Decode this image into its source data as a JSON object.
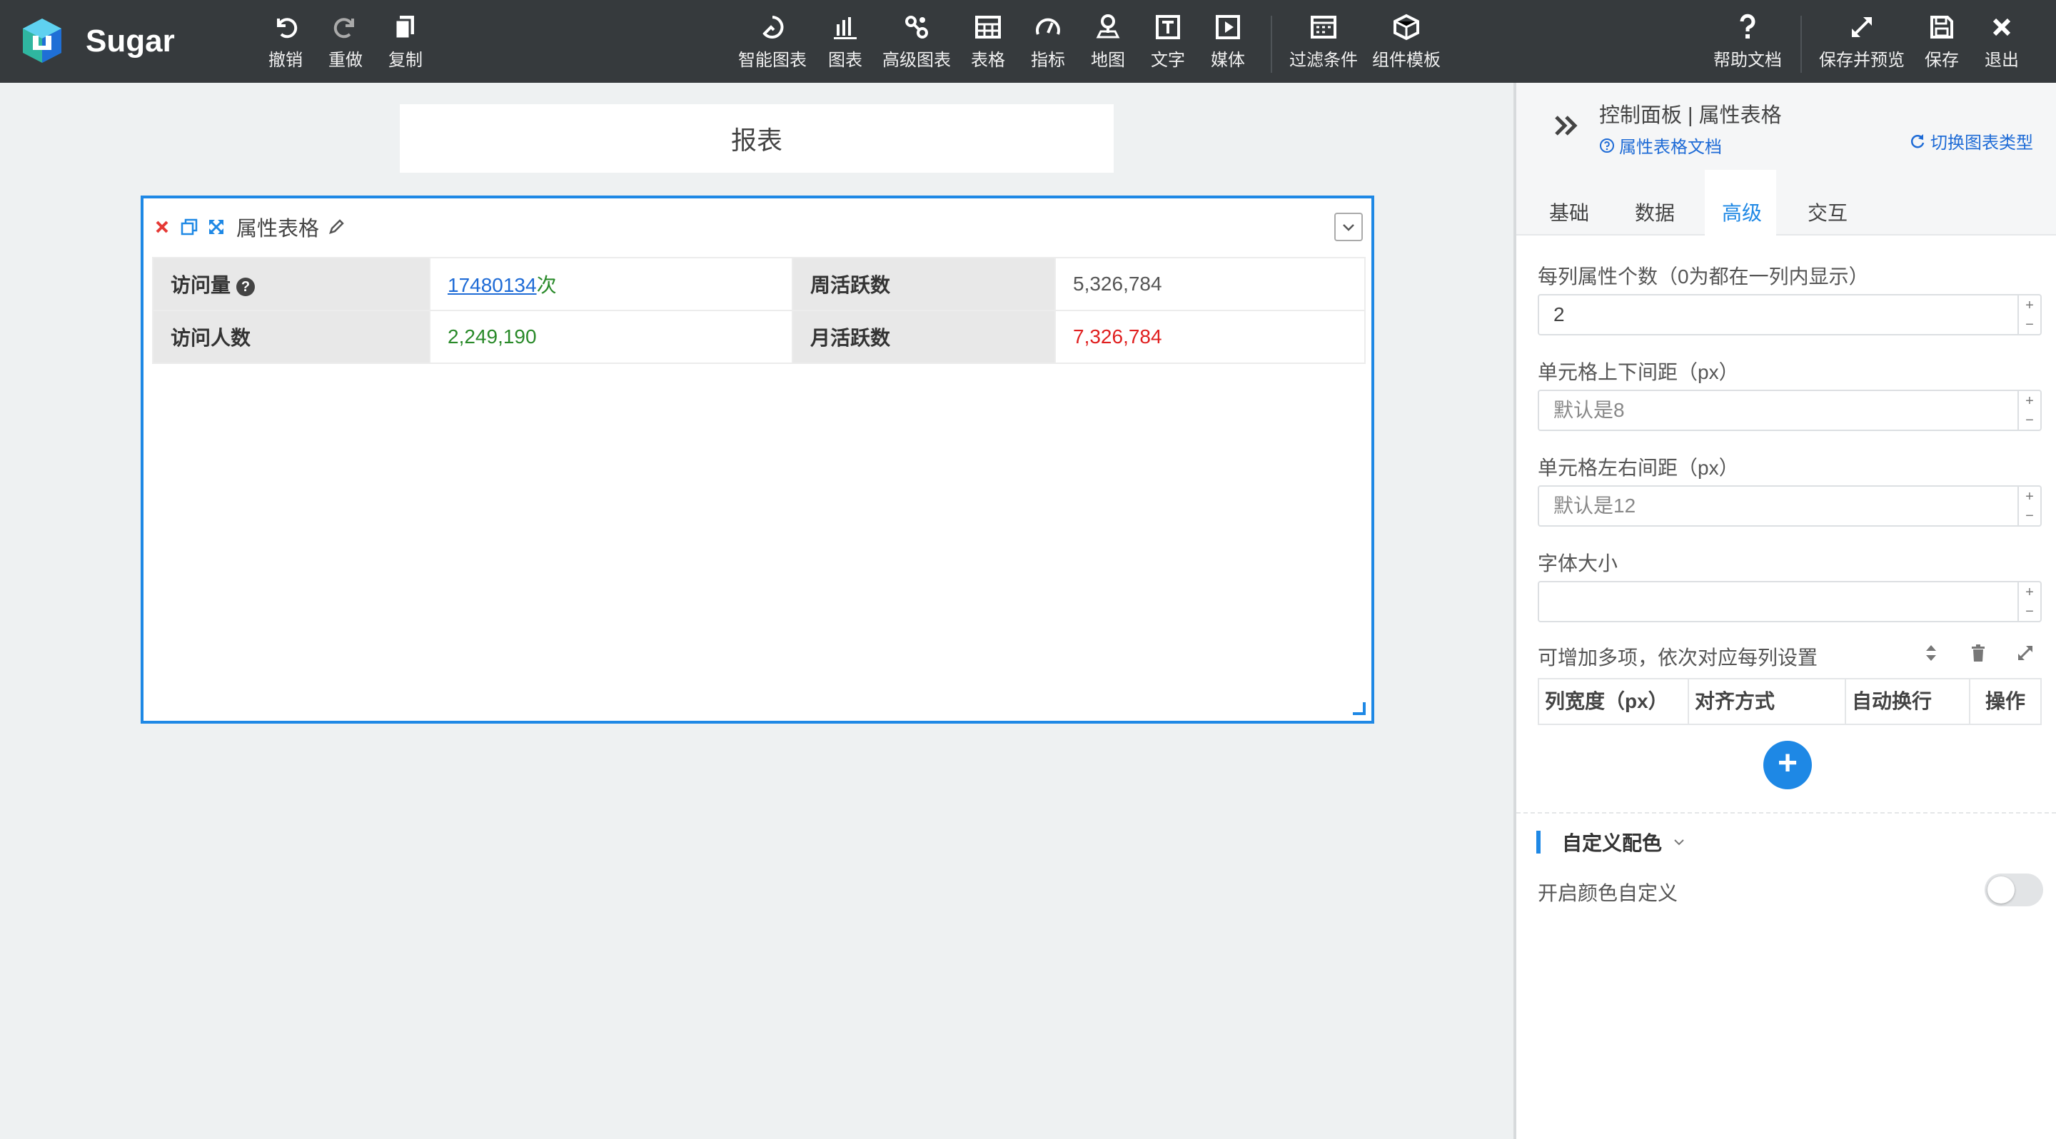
{
  "app": {
    "brand": "Sugar"
  },
  "toolbar": {
    "undo": "撤销",
    "redo": "重做",
    "copy": "复制",
    "smart_chart": "智能图表",
    "chart": "图表",
    "advanced_chart": "高级图表",
    "table": "表格",
    "indicator": "指标",
    "map": "地图",
    "text": "文字",
    "media": "媒体",
    "filter": "过滤条件",
    "component_template": "组件模板",
    "help_doc": "帮助文档",
    "save_preview": "保存并预览",
    "save": "保存",
    "exit": "退出"
  },
  "canvas": {
    "report_title": "报表",
    "widget": {
      "title": "属性表格",
      "rows": [
        {
          "k1": "访问量",
          "v1_link": "17480134",
          "v1_suffix": "次",
          "k2": "周活跃数",
          "v2": "5,326,784"
        },
        {
          "k1": "访问人数",
          "v1": "2,249,190",
          "k2": "月活跃数",
          "v2": "7,326,784"
        }
      ]
    }
  },
  "panel": {
    "title": "控制面板 | 属性表格",
    "doc_link": "属性表格文档",
    "switch_type": "切换图表类型",
    "tabs": [
      "基础",
      "数据",
      "高级",
      "交互"
    ],
    "active_tab": "高级",
    "fields": {
      "per_column_label": "每列属性个数（0为都在一列内显示）",
      "per_column_value": "2",
      "cell_vpad_label": "单元格上下间距（px）",
      "cell_vpad_placeholder": "默认是8",
      "cell_hpad_label": "单元格左右间距（px）",
      "cell_hpad_placeholder": "默认是12",
      "font_size_label": "字体大小",
      "font_size_value": ""
    },
    "multi": {
      "label": "可增加多项，依次对应每列设置",
      "columns": [
        "列宽度（px）",
        "对齐方式",
        "自动换行",
        "操作"
      ],
      "add": "+"
    },
    "color_section": {
      "title": "自定义配色",
      "toggle_label": "开启颜色自定义",
      "toggle_on": false
    }
  },
  "colors": {
    "accent": "#1e88e5",
    "topbar": "#363a3d",
    "link": "#1e6bd6",
    "green": "#2a8a2a",
    "red": "#e01f1f"
  }
}
